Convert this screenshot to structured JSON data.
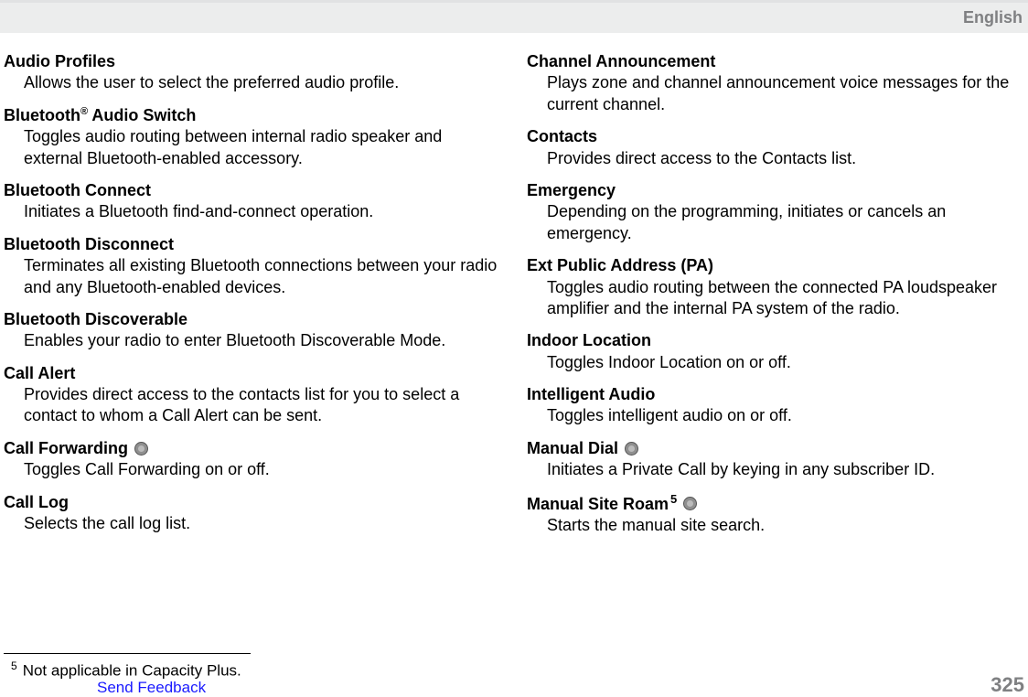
{
  "header": {
    "language": "English"
  },
  "left": [
    {
      "title": "Audio Profiles",
      "desc": "Allows the user to select the preferred audio profile."
    },
    {
      "title": "Bluetooth",
      "title_suffix_sup": "®",
      "title_after": " Audio Switch",
      "desc": "Toggles audio routing between internal radio speaker and external Bluetooth-enabled accessory."
    },
    {
      "title": "Bluetooth Connect",
      "desc": "Initiates a Bluetooth find-and-connect operation."
    },
    {
      "title": "Bluetooth Disconnect",
      "desc": "Terminates all existing Bluetooth connections between your radio and any Bluetooth-enabled devices."
    },
    {
      "title": "Bluetooth Discoverable",
      "desc": "Enables your radio to enter Bluetooth Discoverable Mode."
    },
    {
      "title": "Call Alert",
      "desc": "Provides direct access to the contacts list for you to select a contact to whom a Call Alert can be sent."
    },
    {
      "title": "Call Forwarding",
      "has_badge": true,
      "desc": "Toggles Call Forwarding on or off."
    },
    {
      "title": "Call Log",
      "desc": "Selects the call log list."
    }
  ],
  "right": [
    {
      "title": "Channel Announcement",
      "desc": "Plays zone and channel announcement voice messages for the current channel."
    },
    {
      "title": "Contacts",
      "desc": "Provides direct access to the Contacts list."
    },
    {
      "title": "Emergency",
      "desc": "Depending on the programming, initiates or cancels an emergency."
    },
    {
      "title": "Ext Public Address (PA)",
      "desc": "Toggles audio routing between the connected PA loudspeaker amplifier and the internal PA system of the radio."
    },
    {
      "title": "Indoor Location",
      "desc": "Toggles Indoor Location on or off."
    },
    {
      "title": "Intelligent Audio",
      "desc": "Toggles intelligent audio on or off."
    },
    {
      "title": "Manual Dial",
      "has_badge": true,
      "desc": "Initiates a Private Call by keying in any subscriber ID."
    },
    {
      "title": "Manual Site Roam",
      "sup5": "5",
      "has_badge": true,
      "desc": "Starts the manual site search."
    }
  ],
  "footnote": {
    "marker": "5",
    "text": "Not applicable in Capacity Plus."
  },
  "footer": {
    "feedback": "Send Feedback",
    "page": "325"
  }
}
